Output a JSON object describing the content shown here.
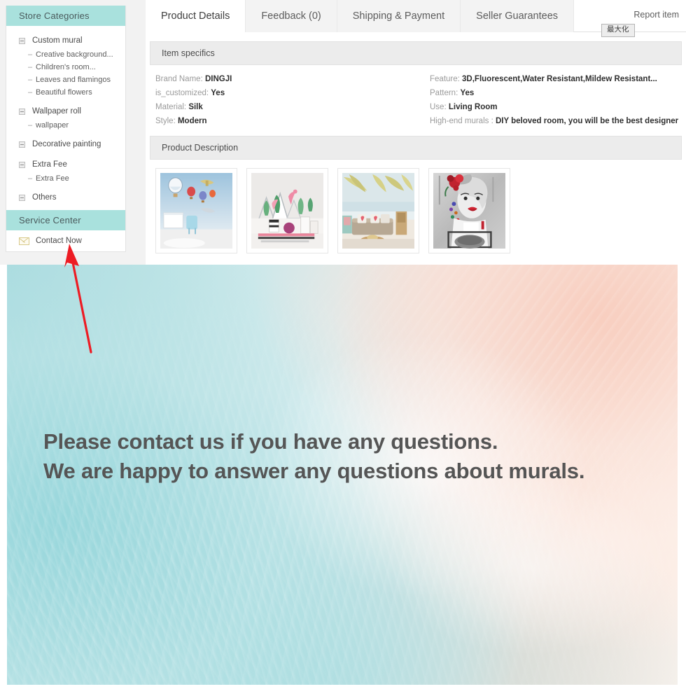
{
  "sidebar": {
    "categories_header": "Store Categories",
    "categories": [
      {
        "label": "Custom mural",
        "type": "top",
        "icon": "tree-expand-icon"
      },
      {
        "label": "Creative background...",
        "type": "sub"
      },
      {
        "label": "Children's room...",
        "type": "sub"
      },
      {
        "label": "Leaves and flamingos",
        "type": "sub"
      },
      {
        "label": "Beautiful flowers",
        "type": "sub"
      },
      {
        "label": "Wallpaper roll",
        "type": "top",
        "icon": "tree-expand-icon"
      },
      {
        "label": "wallpaper",
        "type": "sub"
      },
      {
        "label": "Decorative painting",
        "type": "top",
        "icon": "tree-expand-icon"
      },
      {
        "label": "Extra Fee",
        "type": "top",
        "icon": "tree-expand-icon"
      },
      {
        "label": "Extra Fee",
        "type": "sub"
      },
      {
        "label": "Others",
        "type": "top",
        "icon": "tree-expand-icon"
      }
    ],
    "service_header": "Service Center",
    "contact_now": "Contact Now",
    "contact_icon": "envelope-icon"
  },
  "tabs": [
    {
      "label": "Product Details",
      "active": true
    },
    {
      "label": "Feedback (0)",
      "active": false
    },
    {
      "label": "Shipping & Payment",
      "active": false
    },
    {
      "label": "Seller Guarantees",
      "active": false
    }
  ],
  "report_item": "Report item",
  "maximize_tooltip": "最大化",
  "sections": {
    "item_specifics": "Item specifics",
    "product_description": "Product Description"
  },
  "specs": {
    "left": [
      {
        "label": "Brand Name:",
        "value": "DINGJI"
      },
      {
        "label": "is_customized:",
        "value": "Yes"
      },
      {
        "label": "Material:",
        "value": "Silk"
      },
      {
        "label": "Style:",
        "value": "Modern"
      }
    ],
    "right": [
      {
        "label": "Feature:",
        "value": "3D,Fluorescent,Water Resistant,Mildew Resistant..."
      },
      {
        "label": "Pattern:",
        "value": "Yes"
      },
      {
        "label": "Use:",
        "value": "Living Room"
      },
      {
        "label": "High-end murals :",
        "value": "DIY beloved room, you will be the best designer"
      }
    ]
  },
  "thumbnails": [
    {
      "name": "hot-air-balloons-kids-room-mural"
    },
    {
      "name": "cactus-flamingo-nordic-mural"
    },
    {
      "name": "palm-leaves-seaside-living-room-mural"
    },
    {
      "name": "marilyn-monroe-graffiti-mural"
    }
  ],
  "banner": {
    "line1": "Please contact us if you have any questions.",
    "line2": "We are happy to answer any questions about murals.",
    "text_color": "#555555",
    "accent_teal": "#a9e1dd",
    "accent_peach": "#f8ddd2",
    "arrow_color": "#ed1c24"
  }
}
